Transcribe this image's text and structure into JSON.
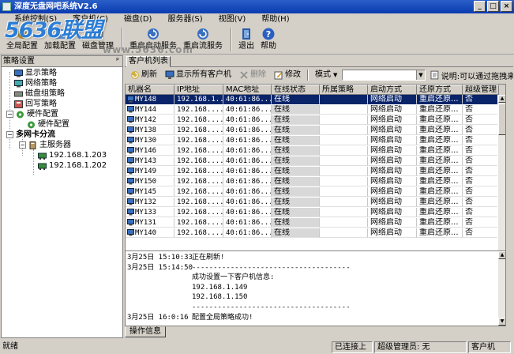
{
  "window": {
    "title": "深度无盘网吧系统V2.6",
    "minimize": "_",
    "maximize": "□",
    "close": "×"
  },
  "logo": {
    "text": "5636联盟",
    "watermark": "www.5636.com"
  },
  "menu": [
    "系统控制(S)",
    "客户机(C)",
    "磁盘(D)",
    "服务器(S)",
    "视图(V)",
    "帮助(H)"
  ],
  "toolbar": {
    "items": [
      {
        "label": "全局配置",
        "icon": "settings-icon"
      },
      {
        "label": "加载配置",
        "icon": "load-config-icon"
      },
      {
        "label": "磁盘管理",
        "icon": "disk-icon"
      },
      {
        "label": "重启启动服务",
        "icon": "restart-service-icon"
      },
      {
        "label": "重启流服务",
        "icon": "restart-stream-icon"
      },
      {
        "label": "退出",
        "icon": "exit-icon"
      },
      {
        "label": "帮助",
        "icon": "help-icon"
      }
    ]
  },
  "left_panel": {
    "title": "策略设置",
    "pin": "ᵖ",
    "nodes": [
      {
        "label": "显示策略"
      },
      {
        "label": "网络策略"
      },
      {
        "label": "磁盘组策略"
      },
      {
        "label": "回写策略"
      },
      {
        "label": "硬件配置"
      },
      {
        "label": "硬件配置"
      },
      {
        "label": "多网卡分流"
      },
      {
        "label": "主服务器"
      },
      {
        "label": "192.168.1.203"
      },
      {
        "label": "192.168.1.202"
      }
    ]
  },
  "right_panel": {
    "tab": "客户机列表",
    "subtoolbar": {
      "refresh": "刷新",
      "show_all": "显示所有客户机",
      "delete": "删除",
      "modify": "修改",
      "mode": "模式",
      "mode_arrow": "▼",
      "hint": "说明:可以通过拖拽来"
    },
    "columns": [
      "机器名",
      "IP地址",
      "MAC地址",
      "在线状态",
      "所属策略",
      "启动方式",
      "还原方式",
      "超级管理"
    ],
    "rows": [
      [
        "MY148",
        "192.168.1...",
        "40:61:86...",
        "在线",
        "",
        "网络启动",
        "重启还原...",
        "否"
      ],
      [
        "MY144",
        "192.168....",
        "40:61:86...",
        "在线",
        "",
        "网络启动",
        "重启还原...",
        "否"
      ],
      [
        "MY142",
        "192.168....",
        "40:61:86...",
        "在线",
        "",
        "网络启动",
        "重启还原...",
        "否"
      ],
      [
        "MY138",
        "192.168....",
        "40:61:86...",
        "在线",
        "",
        "网络启动",
        "重启还原...",
        "否"
      ],
      [
        "MY130",
        "192.168....",
        "40:61:86...",
        "在线",
        "",
        "网络启动",
        "重启还原...",
        "否"
      ],
      [
        "MY146",
        "192.168....",
        "40:61:86...",
        "在线",
        "",
        "网络启动",
        "重启还原...",
        "否"
      ],
      [
        "MY143",
        "192.168....",
        "40:61:86...",
        "在线",
        "",
        "网络启动",
        "重启还原...",
        "否"
      ],
      [
        "MY149",
        "192.168....",
        "40:61:86...",
        "在线",
        "",
        "网络启动",
        "重启还原...",
        "否"
      ],
      [
        "MY150",
        "192.168....",
        "40:61:86...",
        "在线",
        "",
        "网络启动",
        "重启还原...",
        "否"
      ],
      [
        "MY145",
        "192.168....",
        "40:61:86...",
        "在线",
        "",
        "网络启动",
        "重启还原...",
        "否"
      ],
      [
        "MY132",
        "192.168....",
        "40:61:86...",
        "在线",
        "",
        "网络启动",
        "重启还原...",
        "否"
      ],
      [
        "MY133",
        "192.168....",
        "40:61:86...",
        "在线",
        "",
        "网络启动",
        "重启还原...",
        "否"
      ],
      [
        "MY131",
        "192.168....",
        "40:61:86...",
        "在线",
        "",
        "网络启动",
        "重启还原...",
        "否"
      ],
      [
        "MY140",
        "192.168....",
        "40:61:86...",
        "在线",
        "",
        "网络启动",
        "重启还原...",
        "否"
      ]
    ],
    "log": [
      {
        "time": "3月25日 15:10:33",
        "text": "正在刷新!"
      },
      {
        "time": "3月25日 15:14:50",
        "text": "-------------------------------------"
      },
      {
        "time": "",
        "text": "成功设置一下客户机信息:"
      },
      {
        "time": "",
        "text": "192.168.1.149"
      },
      {
        "time": "",
        "text": "192.168.1.150"
      },
      {
        "time": "",
        "text": "-------------------------------------"
      },
      {
        "time": "3月25日 16:0:16",
        "text": "配置全局策略成功!"
      }
    ],
    "log_tab": "操作信息"
  },
  "statusbar": {
    "ready": "就绪",
    "connected": "已连接上",
    "admin": "超级管理员: 无",
    "client": "客户机"
  },
  "colors": {
    "titlebar": "#0a3bb0",
    "selection": "#0a246a",
    "chrome": "#d4d0c8"
  }
}
